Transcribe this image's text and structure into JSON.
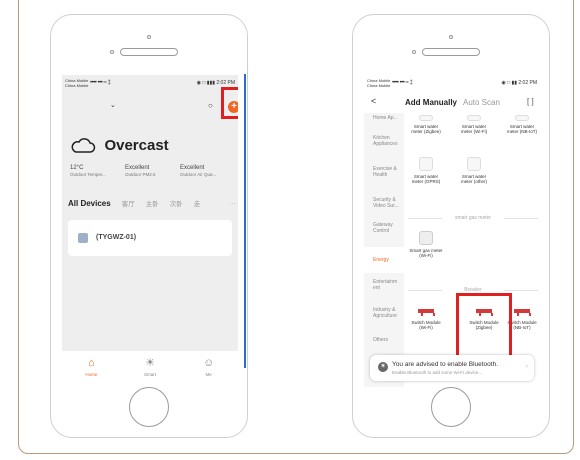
{
  "left_phone": {
    "status": {
      "carrier1": "China Mobile",
      "carrier2": "China Mobile",
      "signal": "•••• ••• ≈ ‡",
      "right": "◉ □ ▮▮▮ 2:02 PM"
    },
    "weather": {
      "condition": "Overcast"
    },
    "stats": [
      {
        "value": "12°C",
        "label": "Outdoor Temper..."
      },
      {
        "value": "Excellent",
        "label": "Outdoor PM2.5"
      },
      {
        "value": "Excellent",
        "label": "Outdoor Air Qua..."
      }
    ],
    "tabs": [
      "All Devices",
      "客厅",
      "主卧",
      "次卧",
      "走",
      "···"
    ],
    "device": {
      "name": "(TYGWZ-01)"
    },
    "nav": [
      {
        "icon": "⌂",
        "label": "Home"
      },
      {
        "icon": "☀",
        "label": "Smart"
      },
      {
        "icon": "☺",
        "label": "Me"
      }
    ]
  },
  "right_phone": {
    "status": {
      "carrier1": "China Mobile",
      "carrier2": "China Mobile",
      "signal": "•••• ••• ≈ ‡",
      "right": "◉ □ ▮▮ 2:02 PM"
    },
    "header": {
      "back": "<",
      "tab_manual": "Add Manually",
      "tab_scan": "Auto Scan",
      "scan_icon": "[ ]"
    },
    "sidebar": [
      "Home Ap...",
      "Kitchen Appliances",
      "Exercise & Health",
      "Security & Video Sur...",
      "Gateway Control",
      "Energy",
      "Entertainm ent",
      "Industry & Agriculture",
      "Others"
    ],
    "water_row1": [
      "Smart water meter (Zigbee)",
      "Smart water meter (Wi-Fi)",
      "Smart water meter (NB-IoT)"
    ],
    "water_row2": [
      "Smart water meter (GPRS)",
      "Smart water meter (other)"
    ],
    "gas_section": "smart gas meter",
    "gas_items": [
      "Smart gas meter (Wi-Fi)"
    ],
    "breaker_section": "Breaker",
    "breaker_items": [
      "Switch Module (Wi-Fi)",
      "Switch Module (Zigbee)",
      "Switch Module (NB-IoT)"
    ],
    "bluetooth": {
      "title": "You are advised to enable Bluetooth.",
      "subtitle": "Enable Bluetooth to add some Wi-Fi device..."
    }
  }
}
